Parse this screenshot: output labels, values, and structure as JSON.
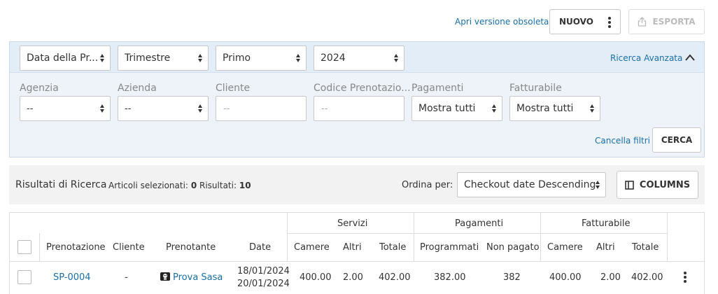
{
  "toolbar": {
    "obsolete_link": "Apri versione obsoleta",
    "new_label": "NUOVO",
    "export_label": "ESPORTA"
  },
  "filters": {
    "date_field": "Data della Pr...",
    "period_type": "Trimestre",
    "period_value": "Primo",
    "year": "2024",
    "advanced_search": "Ricerca Avanzata",
    "fields": {
      "agency": {
        "label": "Agenzia",
        "value": "--"
      },
      "company": {
        "label": "Azienda",
        "value": "--"
      },
      "client": {
        "label": "Cliente",
        "placeholder": "--"
      },
      "booking_code": {
        "label": "Codice Prenotazio...",
        "placeholder": "--"
      },
      "payments": {
        "label": "Pagamenti",
        "value": "Mostra tutti"
      },
      "billable": {
        "label": "Fatturabile",
        "value": "Mostra tutti"
      }
    },
    "clear_label": "Cancella filtri",
    "search_label": "CERCA"
  },
  "results": {
    "title": "Risultati di Ricerca",
    "selected_label": "Articoli selezionati:",
    "selected_count": "0",
    "results_label": "Risultati:",
    "results_count": "10",
    "order_label": "Ordina per:",
    "order_value": "Checkout date Descending",
    "columns_label": "COLUMNS"
  },
  "table": {
    "groups": {
      "services": "Servizi",
      "payments": "Pagamenti",
      "billable": "Fatturabile"
    },
    "headers": {
      "booking": "Prenotazione",
      "client": "Cliente",
      "booker": "Prenotante",
      "date": "Date",
      "rooms": "Camere",
      "others": "Altri",
      "total": "Totale",
      "scheduled": "Programmati",
      "unpaid": "Non pagato",
      "b_rooms": "Camere",
      "b_others": "Altri",
      "b_total": "Totale"
    },
    "rows": [
      {
        "booking": "SP-0004",
        "client": "-",
        "booker": "Prova Sasa",
        "date_from": "18/01/2024",
        "date_to": "20/01/2024",
        "rooms": "400.00",
        "others": "2.00",
        "total": "402.00",
        "scheduled": "382.00",
        "unpaid": "382",
        "b_rooms": "400.00",
        "b_others": "2.00",
        "b_total": "402.00"
      }
    ]
  },
  "colors": {
    "link": "#1a6fa8",
    "filter_bg": "#eef3f9",
    "filter_header_bg": "#e3edf7",
    "results_bar_bg": "#f2f2f2"
  }
}
